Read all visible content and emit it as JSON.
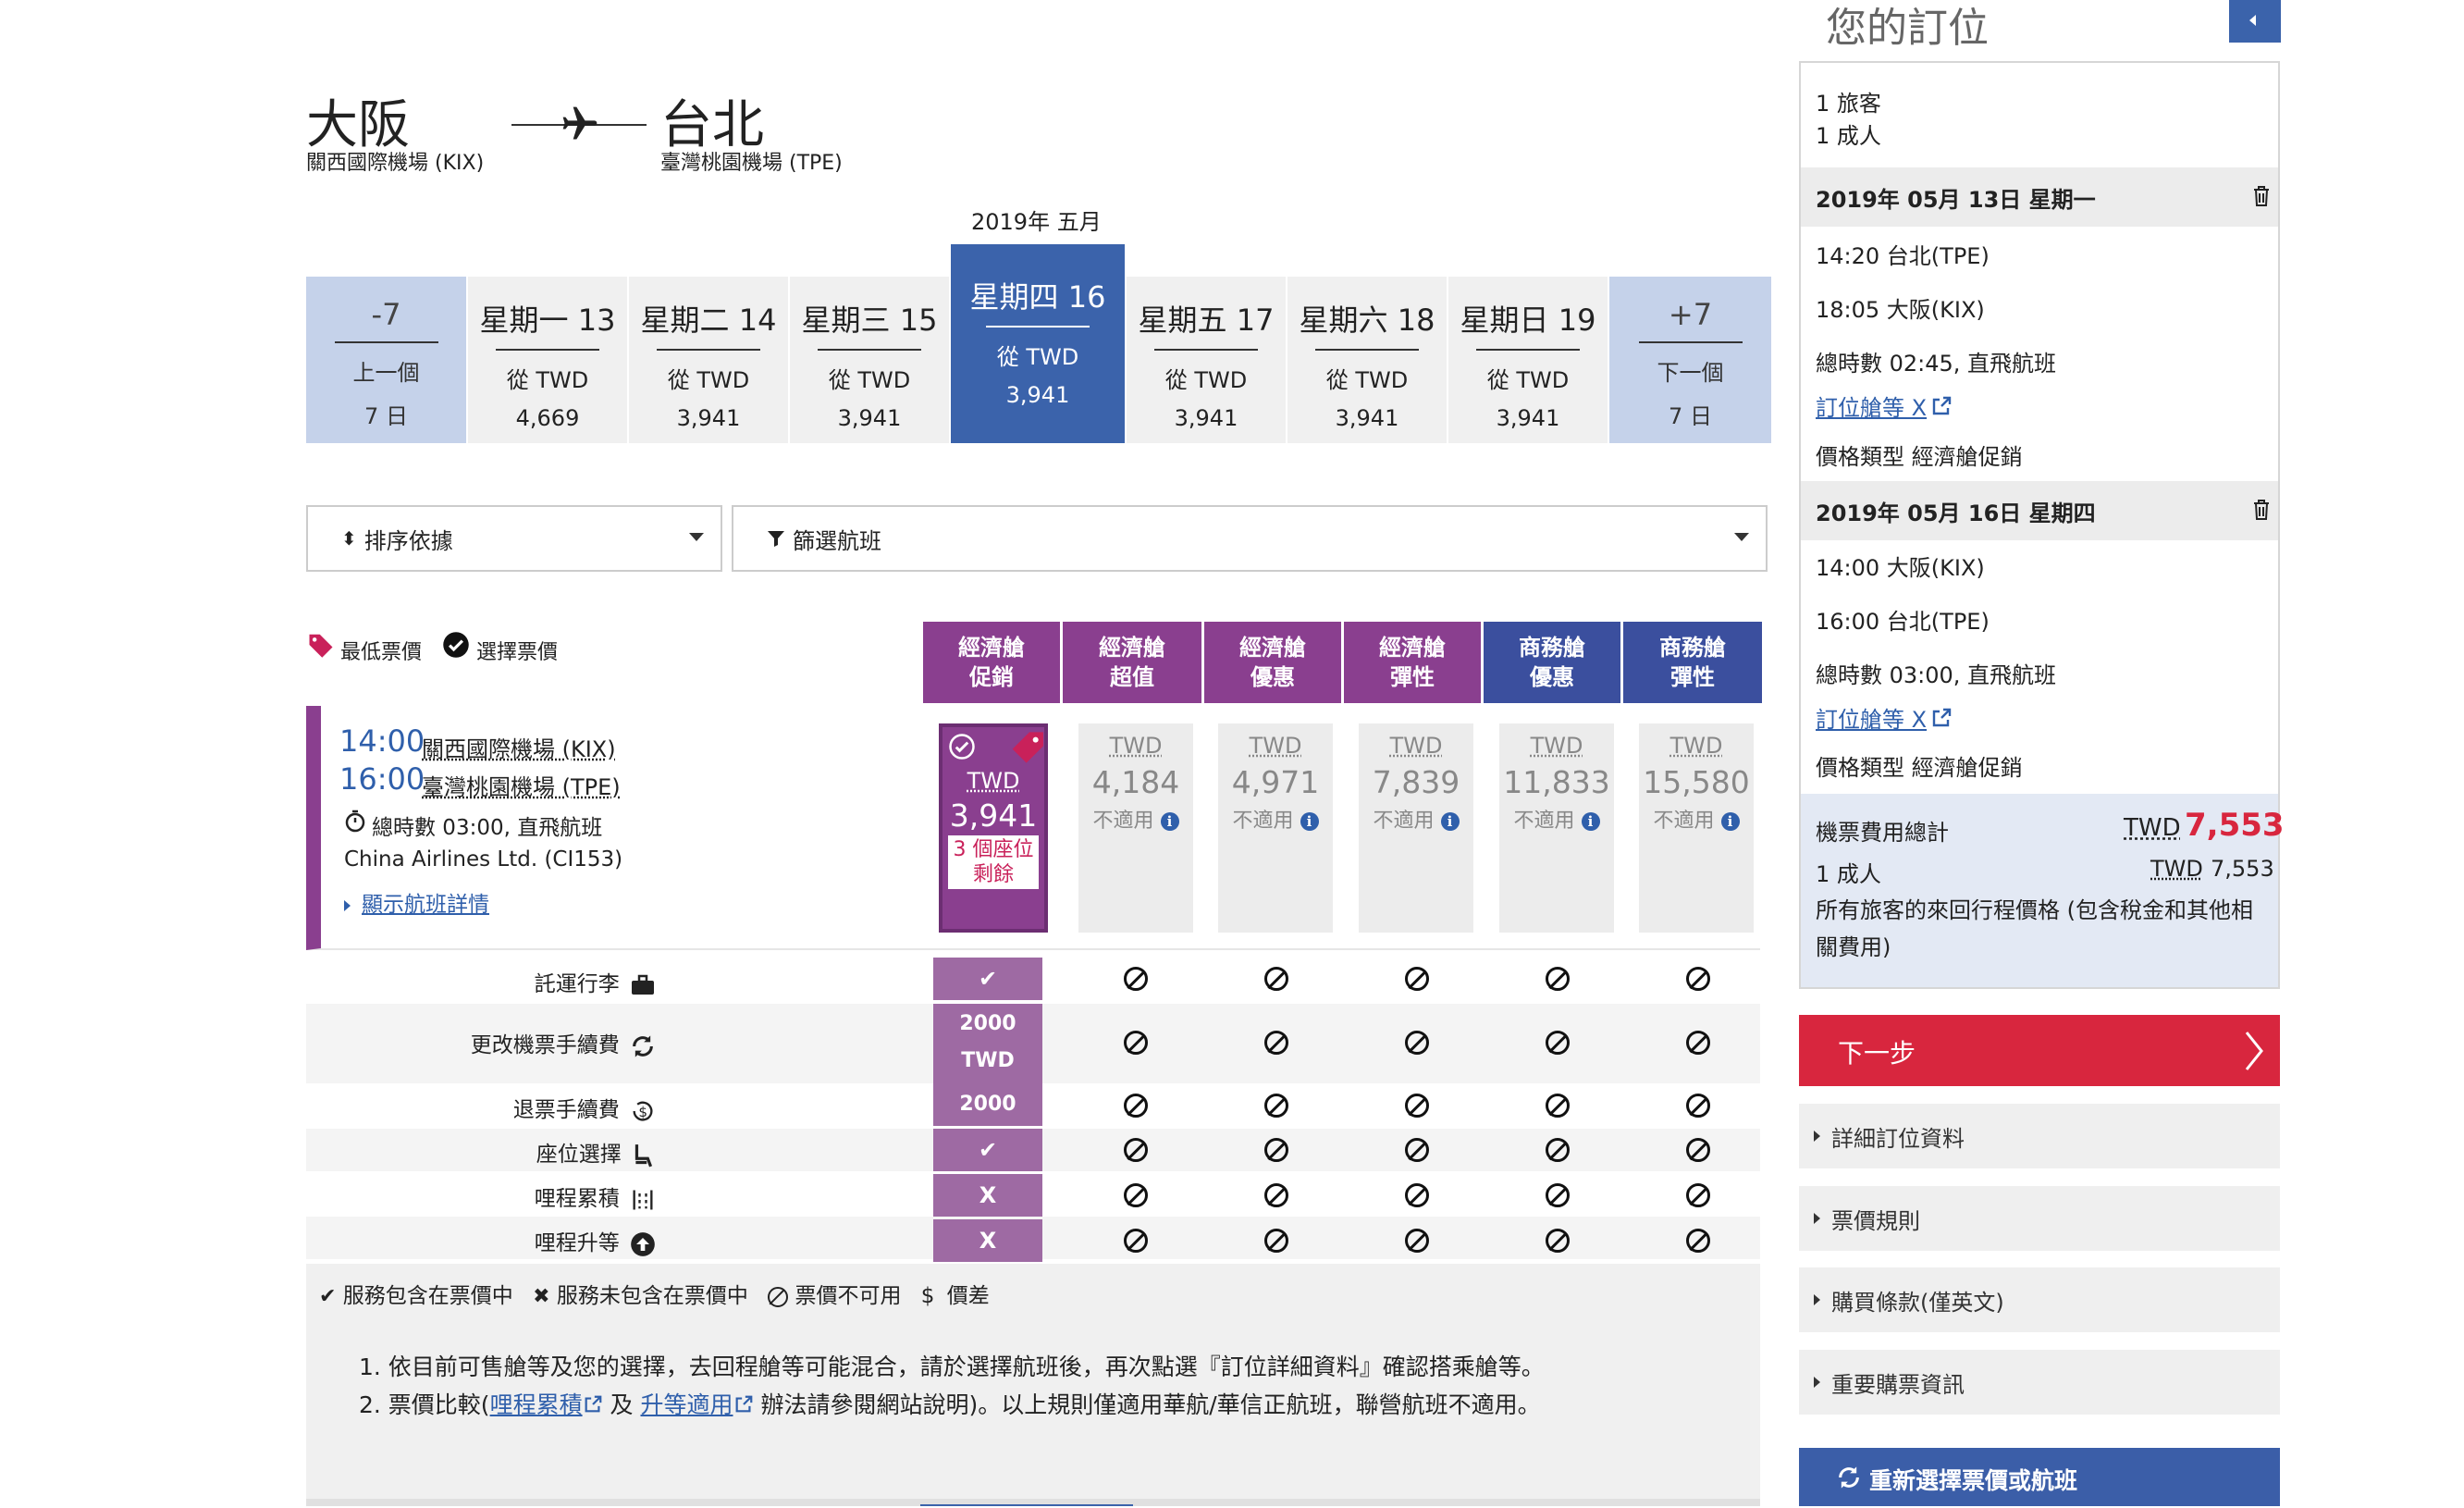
{
  "route": {
    "origin_city": "大阪",
    "origin_airport": "關西國際機場 (KIX)",
    "dest_city": "台北",
    "dest_airport": "臺灣桃園機場 (TPE)"
  },
  "date_strip": {
    "month_label": "2019年 五月",
    "prev": {
      "top": "-7",
      "line1": "上一個",
      "line2": "7 日"
    },
    "next": {
      "top": "+7",
      "line1": "下一個",
      "line2": "7 日"
    },
    "days": [
      {
        "label": "星期一 13",
        "from": "從 TWD",
        "price": "4,669"
      },
      {
        "label": "星期二 14",
        "from": "從 TWD",
        "price": "3,941"
      },
      {
        "label": "星期三 15",
        "from": "從 TWD",
        "price": "3,941"
      },
      {
        "label": "星期四 16",
        "from": "從 TWD",
        "price": "3,941",
        "selected": true
      },
      {
        "label": "星期五 17",
        "from": "從 TWD",
        "price": "3,941"
      },
      {
        "label": "星期六 18",
        "from": "從 TWD",
        "price": "3,941"
      },
      {
        "label": "星期日 19",
        "from": "從 TWD",
        "price": "3,941"
      }
    ]
  },
  "filters": {
    "sort_label": "排序依據",
    "filter_label": "篩選航班"
  },
  "legend": {
    "lowest": "最低票價",
    "selected": "選擇票價"
  },
  "fare_headers": [
    {
      "l1": "經濟艙",
      "l2": "促銷",
      "color": "#8a3f8f"
    },
    {
      "l1": "經濟艙",
      "l2": "超值",
      "color": "#8a3f8f"
    },
    {
      "l1": "經濟艙",
      "l2": "優惠",
      "color": "#8a3f8f"
    },
    {
      "l1": "經濟艙",
      "l2": "彈性",
      "color": "#8a3f8f"
    },
    {
      "l1": "商務艙",
      "l2": "優惠",
      "color": "#3b4f9e"
    },
    {
      "l1": "商務艙",
      "l2": "彈性",
      "color": "#3b4f9e"
    }
  ],
  "flight": {
    "dep_time": "14:00",
    "dep_airport": "關西國際機場 (KIX)",
    "arr_time": "16:00",
    "arr_airport": "臺灣桃園機場 (TPE)",
    "duration": "總時數 03:00, 直飛航班",
    "carrier": "China Airlines Ltd. (CI153)",
    "details_link": "顯示航班詳情"
  },
  "fares": {
    "selected": {
      "cur": "TWD",
      "amount": "3,941",
      "seats": "3 個座位",
      "seats2": "剩餘"
    },
    "others": [
      {
        "cur": "TWD",
        "amount": "4,184",
        "status": "不適用"
      },
      {
        "cur": "TWD",
        "amount": "4,971",
        "status": "不適用"
      },
      {
        "cur": "TWD",
        "amount": "7,839",
        "status": "不適用"
      },
      {
        "cur": "TWD",
        "amount": "11,833",
        "status": "不適用"
      },
      {
        "cur": "TWD",
        "amount": "15,580",
        "status": "不適用"
      }
    ]
  },
  "services": [
    {
      "label": "託運行李",
      "value": "✔",
      "icon": "baggage-icon"
    },
    {
      "label": "更改機票手續費",
      "value": "2000 TWD",
      "value2": "+$",
      "icon": "refresh-icon"
    },
    {
      "label": "退票手續費",
      "value": "2000 TWD",
      "icon": "refund-icon"
    },
    {
      "label": "座位選擇",
      "value": "✔",
      "icon": "seat-icon"
    },
    {
      "label": "哩程累積",
      "value": "X",
      "icon": "mileage-icon"
    },
    {
      "label": "哩程升等",
      "value": "X",
      "icon": "upgrade-icon"
    }
  ],
  "service_legend": {
    "included": "服務包含在票價中",
    "excluded": "服務未包含在票價中",
    "unavailable": "票價不可用",
    "diff": "價差"
  },
  "notes": {
    "n1": "1. 依目前可售艙等及您的選擇，去回程艙等可能混合，請於選擇航班後，再次點選『訂位詳細資料』確認搭乘艙等。",
    "n2_a": "2. 票價比較(",
    "n2_link1": "哩程累積",
    "n2_b": " 及 ",
    "n2_link2": "升等適用",
    "n2_c": " 辦法請參閱網站說明)。以上規則僅適用華航/華信正航班，聯營航班不適用。"
  },
  "summary": {
    "title": "您的訂位",
    "travelers": "1 旅客",
    "adults": "1 成人",
    "leg1": {
      "date": "2019年 05月 13日 星期一",
      "dep": "14:20 台北(TPE)",
      "arr": "18:05 大阪(KIX)",
      "duration": "總時數 02:45, 直飛航班",
      "class_link": "訂位艙等 X",
      "fare_type": "價格類型 經濟艙促銷"
    },
    "leg2": {
      "date": "2019年 05月 16日 星期四",
      "dep": "14:00 大阪(KIX)",
      "arr": "16:00 台北(TPE)",
      "duration": "總時數 03:00, 直飛航班",
      "class_link": "訂位艙等 X",
      "fare_type": "價格類型 經濟艙促銷"
    },
    "total_label": "機票費用總計",
    "total_cur": "TWD",
    "total_amount": "7,553",
    "adult_line": "1 成人",
    "adult_cur": "TWD",
    "adult_amount": "7,553",
    "note": "所有旅客的來回行程價格 (包含稅金和其他相",
    "note2": "關費用)",
    "next_btn": "下一步",
    "accordions": [
      "詳細訂位資料",
      "票價規則",
      "購買條款(僅英文)",
      "重要購票資訊"
    ],
    "reselect_btn": "重新選擇票價或航班"
  },
  "colors": {
    "accent_purple": "#8a3f8f",
    "accent_blue": "#3b63ab",
    "next_red": "#d8263e"
  }
}
